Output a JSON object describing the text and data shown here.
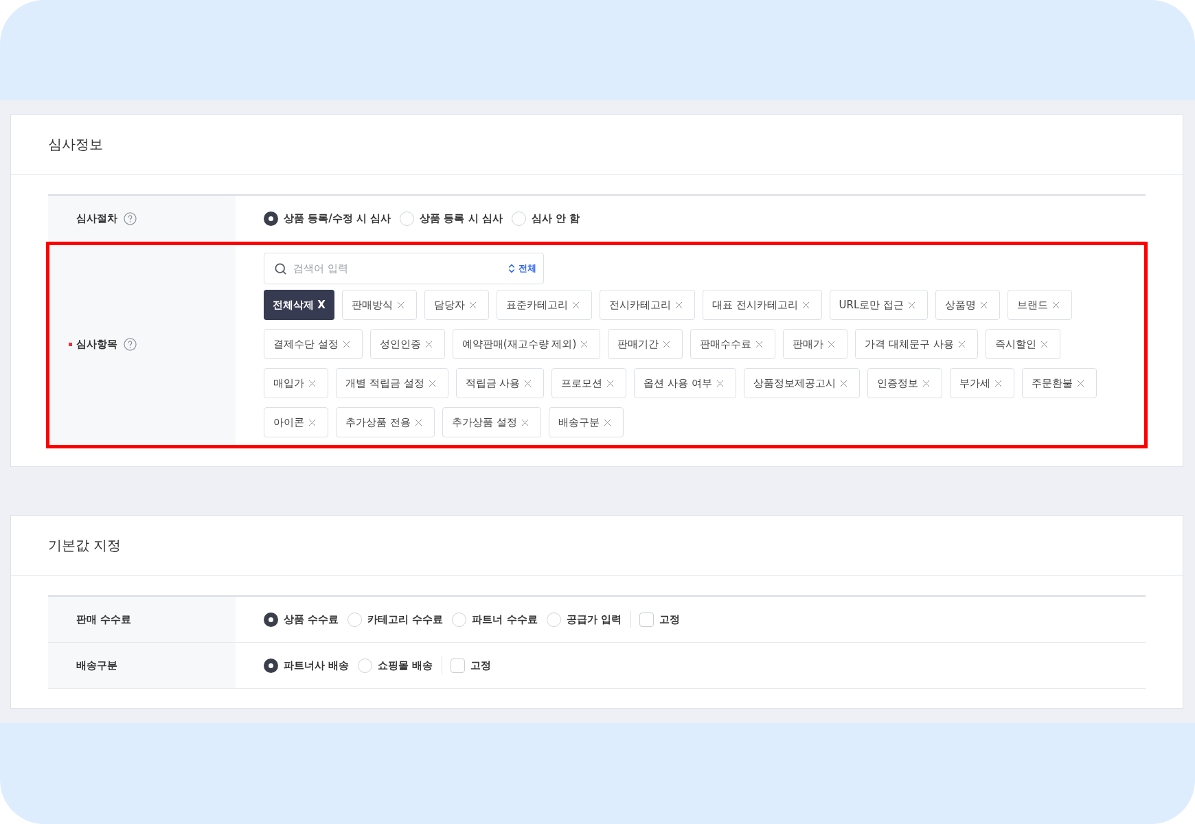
{
  "sections": [
    {
      "title": "심사정보",
      "rows": [
        {
          "kind": "radio",
          "label": "심사절차",
          "required": false,
          "help": true,
          "highlighted": false,
          "options": [
            {
              "label": "상품 등록/수정 시 심사",
              "selected": true
            },
            {
              "label": "상품 등록 시 심사",
              "selected": false
            },
            {
              "label": "심사 안 함",
              "selected": false
            }
          ]
        },
        {
          "kind": "tags",
          "label": "심사항목",
          "required": true,
          "help": true,
          "highlighted": true,
          "search": {
            "placeholder": "검색어 입력",
            "toggle": "전체"
          },
          "clear_all": "전체삭제 X",
          "tags": [
            "판매방식",
            "담당자",
            "표준카테고리",
            "전시카테고리",
            "대표 전시카테고리",
            "URL로만 접근",
            "상품명",
            "브랜드",
            "결제수단 설정",
            "성인인증",
            "예약판매(재고수량 제외)",
            "판매기간",
            "판매수수료",
            "판매가",
            "가격 대체문구 사용",
            "즉시할인",
            "매입가",
            "개별 적립금 설정",
            "적립금 사용",
            "프로모션",
            "옵션 사용 여부",
            "상품정보제공고시",
            "인증정보",
            "부가세",
            "주문환불",
            "아이콘",
            "추가상품 전용",
            "추가상품 설정",
            "배송구분"
          ]
        }
      ]
    },
    {
      "title": "기본값 지정",
      "rows": [
        {
          "kind": "radio",
          "label": "판매 수수료",
          "required": false,
          "help": false,
          "highlighted": false,
          "options": [
            {
              "label": "상품 수수료",
              "selected": true
            },
            {
              "label": "카테고리 수수료",
              "selected": false
            },
            {
              "label": "파트너 수수료",
              "selected": false
            },
            {
              "label": "공급가 입력",
              "selected": false
            }
          ],
          "fixed": {
            "label": "고정",
            "checked": false
          }
        },
        {
          "kind": "radio",
          "label": "배송구분",
          "required": false,
          "help": false,
          "highlighted": false,
          "options": [
            {
              "label": "파트너사 배송",
              "selected": true
            },
            {
              "label": "쇼핑몰 배송",
              "selected": false
            }
          ],
          "fixed": {
            "label": "고정",
            "checked": false
          }
        }
      ]
    }
  ]
}
